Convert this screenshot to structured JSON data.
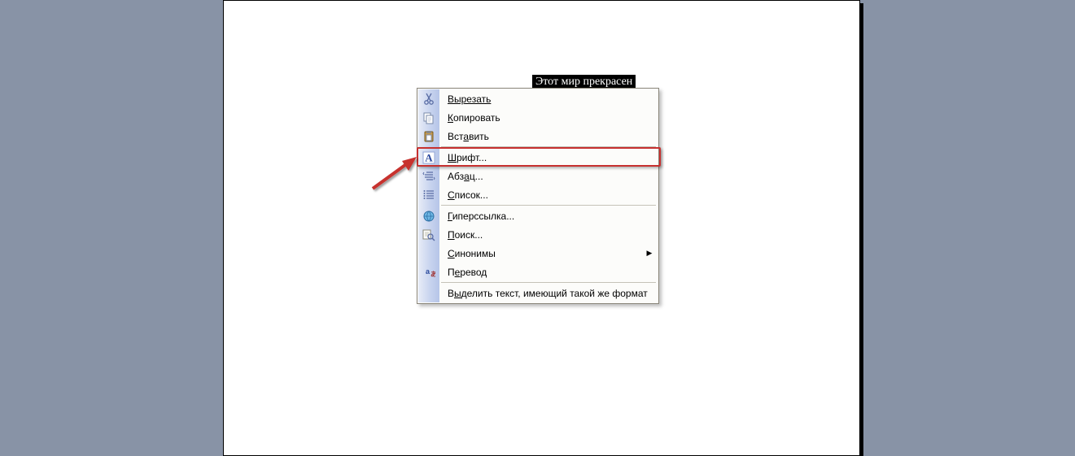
{
  "document": {
    "selected_text": "Этот мир прекрасен"
  },
  "context_menu": {
    "items": [
      {
        "icon": "cut-icon",
        "label": "Вырезать",
        "accel_idx": 0
      },
      {
        "icon": "copy-icon",
        "label": "Копировать",
        "accel_idx": 0
      },
      {
        "icon": "paste-icon",
        "label": "Вставить",
        "accel_idx": 3
      },
      {
        "sep": true
      },
      {
        "icon": "font-icon",
        "label": "Шрифт...",
        "accel_idx": 0,
        "highlighted": true
      },
      {
        "icon": "paragraph-icon",
        "label": "Абзац...",
        "accel_idx": 3
      },
      {
        "icon": "list-icon",
        "label": "Список...",
        "accel_idx": 0
      },
      {
        "sep": true
      },
      {
        "icon": "hyperlink-icon",
        "label": "Гиперссылка...",
        "accel_idx": 0
      },
      {
        "icon": "search-icon",
        "label": "Поиск...",
        "accel_idx": 0
      },
      {
        "icon": "",
        "label": "Синонимы",
        "accel_idx": 0,
        "submenu": true
      },
      {
        "icon": "translate-icon",
        "label": "Перевод",
        "accel_idx": 1
      },
      {
        "sep": true
      },
      {
        "icon": "",
        "label": "Выделить текст, имеющий такой же формат",
        "accel_idx": 1
      }
    ]
  }
}
